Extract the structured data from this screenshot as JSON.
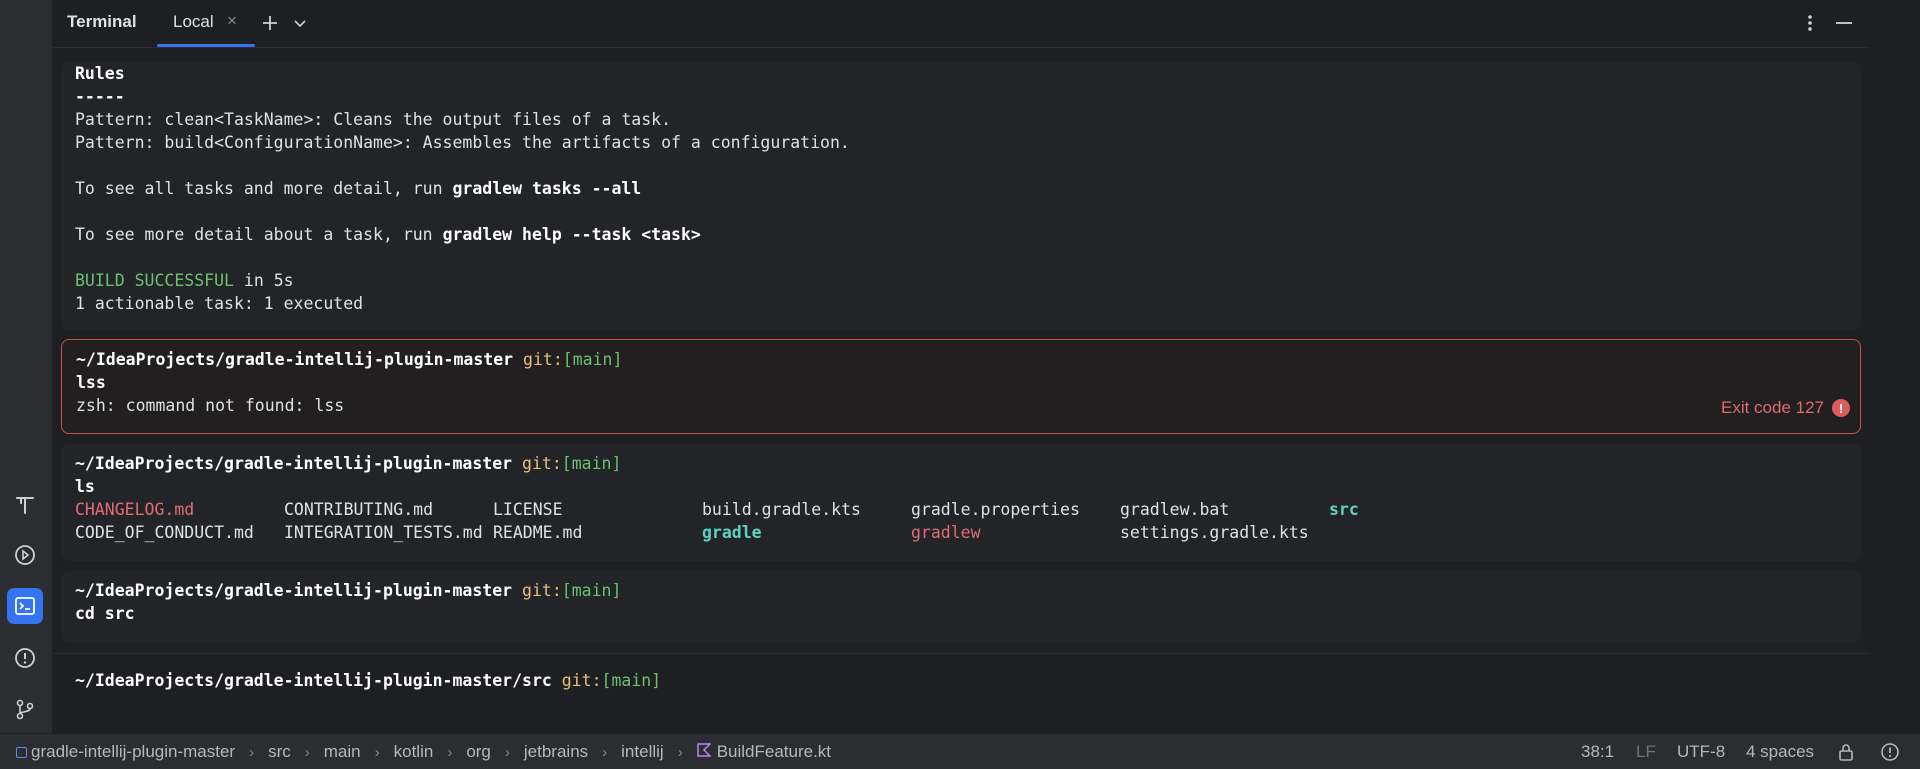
{
  "header": {
    "title": "Terminal",
    "tab_label": "Local",
    "tab_close": "×",
    "add_tab": "+",
    "dropdown": "⌄",
    "menu": "⋮",
    "minimize": "—"
  },
  "blocks": {
    "output": {
      "lines": [
        {
          "segments": [
            {
              "text": "Rules",
              "style": "bold"
            }
          ]
        },
        {
          "segments": [
            {
              "text": "-----",
              "style": "bold"
            }
          ]
        },
        {
          "segments": [
            {
              "text": "Pattern: clean<TaskName>: Cleans the output files of a task.",
              "style": "normal"
            }
          ]
        },
        {
          "segments": [
            {
              "text": "Pattern: build<ConfigurationName>: Assembles the artifacts of a configuration.",
              "style": "normal"
            }
          ]
        },
        {
          "segments": [
            {
              "text": "",
              "style": "normal"
            }
          ]
        },
        {
          "segments": [
            {
              "text": "To see all tasks and more detail, run ",
              "style": "normal"
            },
            {
              "text": "gradlew tasks --all",
              "style": "bold"
            }
          ]
        },
        {
          "segments": [
            {
              "text": "",
              "style": "normal"
            }
          ]
        },
        {
          "segments": [
            {
              "text": "To see more detail about a task, run ",
              "style": "normal"
            },
            {
              "text": "gradlew help --task <task>",
              "style": "bold"
            }
          ]
        },
        {
          "segments": [
            {
              "text": "",
              "style": "normal"
            }
          ]
        },
        {
          "segments": [
            {
              "text": "BUILD SUCCESSFUL",
              "style": "green"
            },
            {
              "text": " in 5s",
              "style": "normal"
            }
          ]
        },
        {
          "segments": [
            {
              "text": "1 actionable task: 1 executed",
              "style": "normal"
            }
          ]
        }
      ]
    },
    "error_block": {
      "path": "~/IdeaProjects/gradle-intellij-plugin-master",
      "git_prefix": "git:",
      "branch": "[main]",
      "command": "lss",
      "output": "zsh: command not found: lss",
      "exit_code": "Exit code 127",
      "exit_icon": "!"
    },
    "ls_block": {
      "path": "~/IdeaProjects/gradle-intellij-plugin-master",
      "git_prefix": "git:",
      "branch": "[main]",
      "command": "ls",
      "row1": [
        {
          "text": "CHANGELOG.md",
          "style": "red"
        },
        {
          "text": "CONTRIBUTING.md",
          "style": "normal"
        },
        {
          "text": "LICENSE",
          "style": "normal"
        },
        {
          "text": "build.gradle.kts",
          "style": "normal"
        },
        {
          "text": "gradle.properties",
          "style": "normal"
        },
        {
          "text": "gradlew.bat",
          "style": "normal"
        },
        {
          "text": "src",
          "style": "cyan"
        }
      ],
      "row2": [
        {
          "text": "CODE_OF_CONDUCT.md",
          "style": "normal"
        },
        {
          "text": "INTEGRATION_TESTS.md",
          "style": "normal"
        },
        {
          "text": "README.md",
          "style": "normal"
        },
        {
          "text": "gradle",
          "style": "cyan"
        },
        {
          "text": "gradlew",
          "style": "red"
        },
        {
          "text": "settings.gradle.kts",
          "style": "normal"
        }
      ]
    },
    "cd_block": {
      "path": "~/IdeaProjects/gradle-intellij-plugin-master",
      "git_prefix": "git:",
      "branch": "[main]",
      "command": "cd src"
    },
    "prompt": {
      "path": "~/IdeaProjects/gradle-intellij-plugin-master/src",
      "git_prefix": "git:",
      "branch": "[main]"
    }
  },
  "left_toolbar": [
    {
      "name": "build-icon",
      "glyph": "T"
    },
    {
      "name": "run-icon",
      "glyph": "▷"
    },
    {
      "name": "terminal-icon",
      "glyph": ">_",
      "active": true
    },
    {
      "name": "problems-icon",
      "glyph": "!"
    },
    {
      "name": "git-icon",
      "glyph": "⑂"
    }
  ],
  "statusbar": {
    "breadcrumbs": [
      "gradle-intellij-plugin-master",
      "src",
      "main",
      "kotlin",
      "org",
      "jetbrains",
      "intellij",
      "BuildFeature.kt"
    ],
    "position": "38:1",
    "line_ending": "LF",
    "encoding": "UTF-8",
    "indent": "4 spaces"
  },
  "colors": {
    "accent": "#3574f0",
    "error": "#c75450",
    "success": "#6ac26f",
    "branch": "#6ac26f",
    "git": "#e5c07b"
  }
}
